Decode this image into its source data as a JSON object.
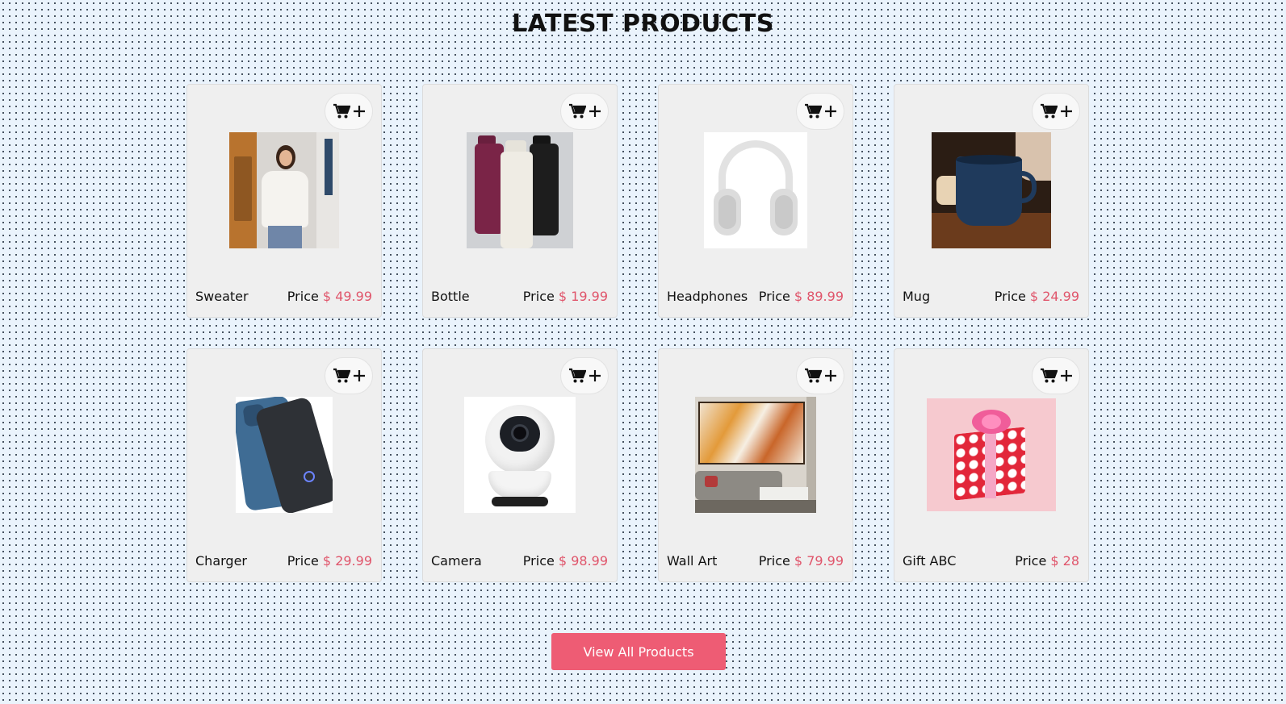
{
  "section": {
    "title": "LATEST PRODUCTS"
  },
  "products": [
    {
      "name": "Sweater",
      "price_label": "Price",
      "price": "$ 49.99",
      "image": "sweater-photo"
    },
    {
      "name": "Bottle",
      "price_label": "Price",
      "price": "$ 19.99",
      "image": "bottle-photo"
    },
    {
      "name": "Headphones",
      "price_label": "Price",
      "price": "$ 89.99",
      "image": "headphones-photo"
    },
    {
      "name": "Mug",
      "price_label": "Price",
      "price": "$ 24.99",
      "image": "mug-photo"
    },
    {
      "name": "Charger",
      "price_label": "Price",
      "price": "$ 29.99",
      "image": "charger-photo"
    },
    {
      "name": "Camera",
      "price_label": "Price",
      "price": "$ 98.99",
      "image": "camera-photo"
    },
    {
      "name": "Wall Art",
      "price_label": "Price",
      "price": "$ 79.99",
      "image": "wall-art-photo"
    },
    {
      "name": "Gift ABC",
      "price_label": "Price",
      "price": "$ 28",
      "image": "gift-photo"
    }
  ],
  "cart_icon": "cart-plus-icon",
  "view_all": {
    "label": "View All Products"
  },
  "colors": {
    "accent": "#ee5c74",
    "price": "#e0556b",
    "page_bg": "#eaf3fc",
    "card_bg": "#efefef"
  }
}
